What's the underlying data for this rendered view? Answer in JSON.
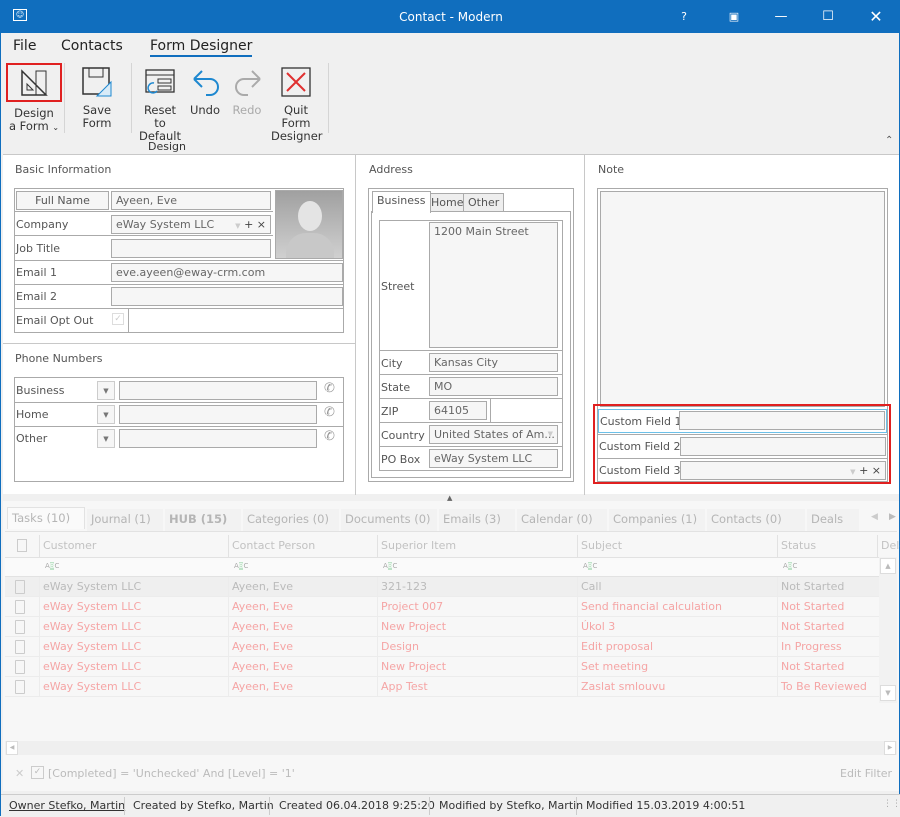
{
  "window": {
    "title": "Contact - Modern",
    "accent": "#106ebe",
    "icons": [
      "contact-card-icon",
      "help-icon",
      "restore-icon",
      "minimize-icon",
      "maximize-icon",
      "close-icon"
    ]
  },
  "menu": [
    "File",
    "Contacts",
    "Form Designer"
  ],
  "ribbon": {
    "buttons": [
      {
        "label1": "Design",
        "label2": "a Form",
        "icon": "set-square-icon"
      },
      {
        "label1": "Save Form",
        "label2": "",
        "icon": "save-form-icon"
      },
      {
        "label1": "Reset to",
        "label2": "Default",
        "icon": "reset-icon"
      },
      {
        "label1": "Undo",
        "label2": "",
        "icon": "undo-icon"
      },
      {
        "label1": "Redo",
        "label2": "",
        "icon": "redo-icon"
      },
      {
        "label1": "Quit Form",
        "label2": "Designer",
        "icon": "quit-icon"
      }
    ],
    "group": "Design"
  },
  "basic": {
    "title": "Basic Information",
    "full_name_label": "Full Name",
    "full_name": "Ayeen, Eve",
    "company_label": "Company",
    "company": "eWay System LLC",
    "job_title_label": "Job Title",
    "job_title": "",
    "email1_label": "Email 1",
    "email1": "eve.ayeen@eway-crm.com",
    "email2_label": "Email 2",
    "email2": "",
    "opt_out_label": "Email Opt Out",
    "opt_out": true
  },
  "phones": {
    "title": "Phone Numbers",
    "items": [
      "Business",
      "Home",
      "Other"
    ]
  },
  "address": {
    "title": "Address",
    "tabs": [
      "Business",
      "Home",
      "Other"
    ],
    "street_label": "Street",
    "street": "1200 Main Street",
    "city_label": "City",
    "city": "Kansas City",
    "state_label": "State",
    "state": "MO",
    "zip_label": "ZIP",
    "zip": "64105",
    "country_label": "Country",
    "country": "United States of Am...",
    "pobox_label": "PO Box",
    "pobox": "eWay System LLC"
  },
  "note": {
    "title": "Note",
    "custom1": "Custom Field 1",
    "custom2": "Custom Field 2",
    "custom3": "Custom Field 3"
  },
  "tabs": [
    "Tasks (10)",
    "Journal (1)",
    "HUB (15)",
    "Categories (0)",
    "Documents (0)",
    "Emails (3)",
    "Calendar (0)",
    "Companies (1)",
    "Contacts (0)",
    "Deals"
  ],
  "grid": {
    "columns": [
      "Customer",
      "Contact Person",
      "Superior Item",
      "Subject",
      "Status",
      "Dele"
    ],
    "rows": [
      [
        "eWay System LLC",
        "Ayeen, Eve",
        "321-123",
        "Call",
        "Not Started"
      ],
      [
        "eWay System LLC",
        "Ayeen, Eve",
        "Project 007",
        "Send financial calculation",
        "Not Started"
      ],
      [
        "eWay System LLC",
        "Ayeen, Eve",
        "New Project",
        "Úkol 3",
        "Not Started"
      ],
      [
        "eWay System LLC",
        "Ayeen, Eve",
        "Design",
        "Edit proposal",
        "In Progress"
      ],
      [
        "eWay System LLC",
        "Ayeen, Eve",
        "New Project",
        "Set meeting",
        "Not Started"
      ],
      [
        "eWay System LLC",
        "Ayeen, Eve",
        "App Test",
        "Zaslat smlouvu",
        "To Be Reviewed"
      ]
    ],
    "overdue_color": "#f5a5a5"
  },
  "filter": {
    "text": "[Completed] = 'Unchecked' And [Level] = '1'",
    "edit": "Edit Filter"
  },
  "status": {
    "owner": "Owner Stefko, Martin",
    "created_by": "Created by Stefko, Martin",
    "created": "Created 06.04.2018 9:25:20",
    "modified_by": "Modified by Stefko, Martin",
    "modified": "Modified 15.03.2019 4:00:51"
  }
}
